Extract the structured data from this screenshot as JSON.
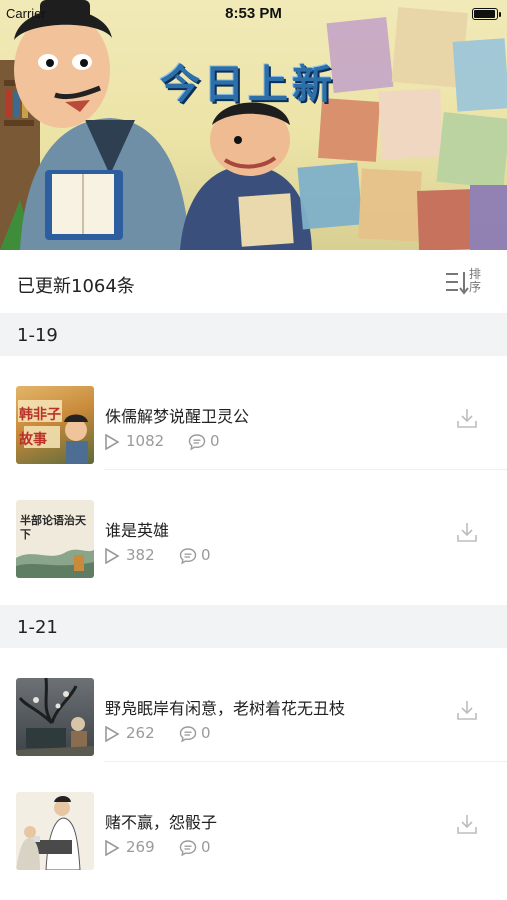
{
  "status_bar": {
    "carrier": "Carrier",
    "time": "8:53 PM",
    "battery_level": 1.0
  },
  "banner": {
    "title": "今日上新"
  },
  "summary": {
    "updated_count_text": "已更新1064条",
    "sort_label": "排序",
    "sort_icon": "sort-icon"
  },
  "sections": [
    {
      "title": "1-19",
      "items": [
        {
          "title": "侏儒解梦说醒卫灵公",
          "plays": "1082",
          "comments": "0",
          "thumb_text": "韩非子故事",
          "thumb_colors": [
            "#c98a3a",
            "#5a6b3c"
          ]
        },
        {
          "title": "谁是英雄",
          "plays": "382",
          "comments": "0",
          "thumb_text": "半部论语治天下",
          "thumb_colors": [
            "#e9e4d2",
            "#6d8a6a"
          ]
        }
      ]
    },
    {
      "title": "1-21",
      "items": [
        {
          "title": "野凫眠岸有闲意，老树着花无丑枝",
          "plays": "262",
          "comments": "0",
          "thumb_text": "",
          "thumb_colors": [
            "#5d6166",
            "#2f3a3c"
          ]
        },
        {
          "title": "赌不赢，怨骰子",
          "plays": "269",
          "comments": "0",
          "thumb_text": "",
          "thumb_colors": [
            "#f1ece2",
            "#4a4a4a"
          ]
        }
      ]
    }
  ],
  "icons": {
    "play": "play-icon",
    "comment": "comment-icon",
    "download": "download-icon"
  },
  "colors": {
    "section_bg": "#f2f3f4",
    "meta_text": "#9a9a9a",
    "banner_title": "#2d6fa8"
  }
}
